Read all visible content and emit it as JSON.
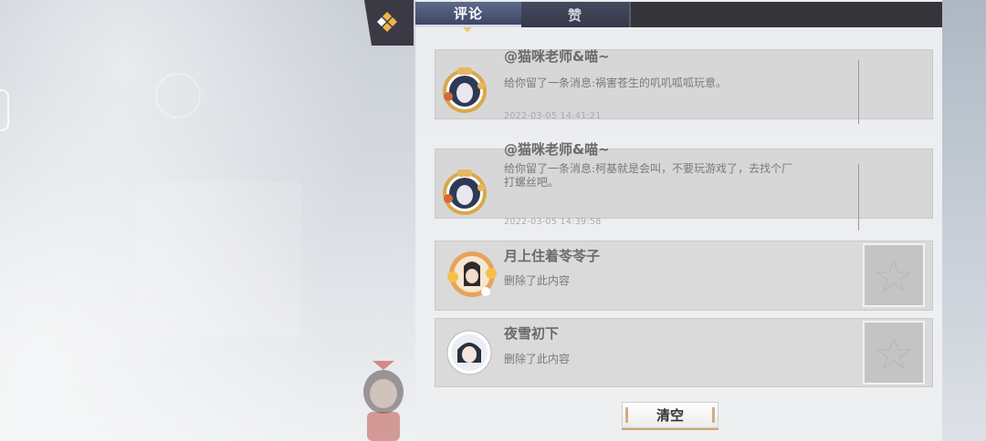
{
  "tabs": [
    {
      "label": "评论",
      "active": true
    },
    {
      "label": "赞",
      "active": false
    }
  ],
  "messages": [
    {
      "name": "@猫咪老师&喵~",
      "lines": [
        "给你留了一条消息:祸害苍生的叽叽呱呱玩意。"
      ],
      "time": "2022-03-05 14:41:21",
      "avatar": "framed-avatar-gold"
    },
    {
      "name": "@猫咪老师&喵~",
      "lines": [
        "给你留了一条消息:柯基就是会叫，不要玩游戏了，去找个厂",
        "打螺丝吧。"
      ],
      "time": "2022-03-05 14:39:58",
      "avatar": "framed-avatar-gold"
    },
    {
      "name": "月上住着苓苓子",
      "lines": [
        "删除了此内容"
      ],
      "time": "",
      "avatar": "framed-avatar-floral"
    },
    {
      "name": "夜雪初下",
      "lines": [
        "删除了此内容"
      ],
      "time": "",
      "avatar": "round-avatar"
    }
  ],
  "clear_button": "清空",
  "colors": {
    "tab_active": "#4a5578",
    "tab_bar": "#35343b",
    "card_bg": "#d7d7d7",
    "accent_gold": "#c9a96a"
  },
  "icons": {
    "badge": "diamond-cluster-icon",
    "thumb": "star-placeholder-icon"
  }
}
